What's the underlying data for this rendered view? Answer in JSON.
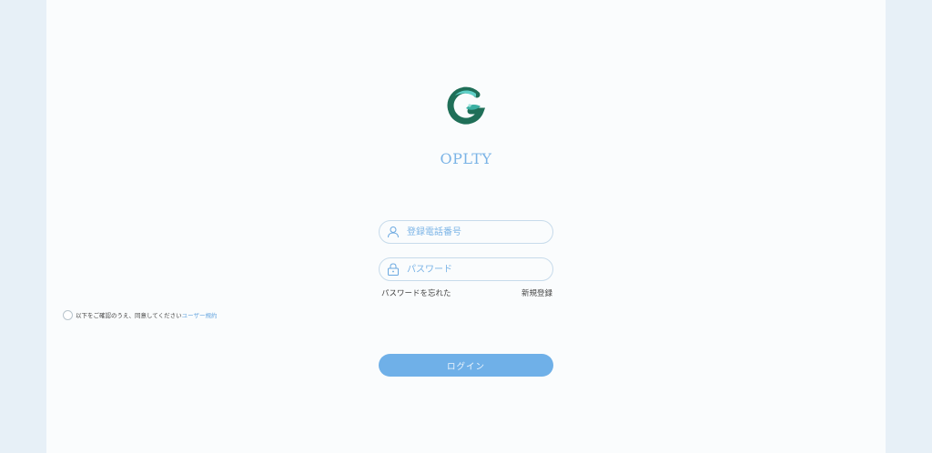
{
  "brand": {
    "name": "OPLTY",
    "logo_icon": "g-leaf-logo-icon",
    "colors": {
      "teal": "#3bb0a3",
      "dark_green": "#1f6f58",
      "accent": "#6fb0e8"
    }
  },
  "form": {
    "phone": {
      "placeholder": "登録電話番号",
      "value": "",
      "icon": "user-icon"
    },
    "password": {
      "placeholder": "パスワード",
      "value": "",
      "icon": "lock-icon"
    },
    "forgot_label": "パスワードを忘れた",
    "register_label": "新規登録",
    "agree_text": "以下をご確認のうえ、同意してください",
    "terms_link": "ユーザー規約",
    "login_label": "ログイン"
  }
}
